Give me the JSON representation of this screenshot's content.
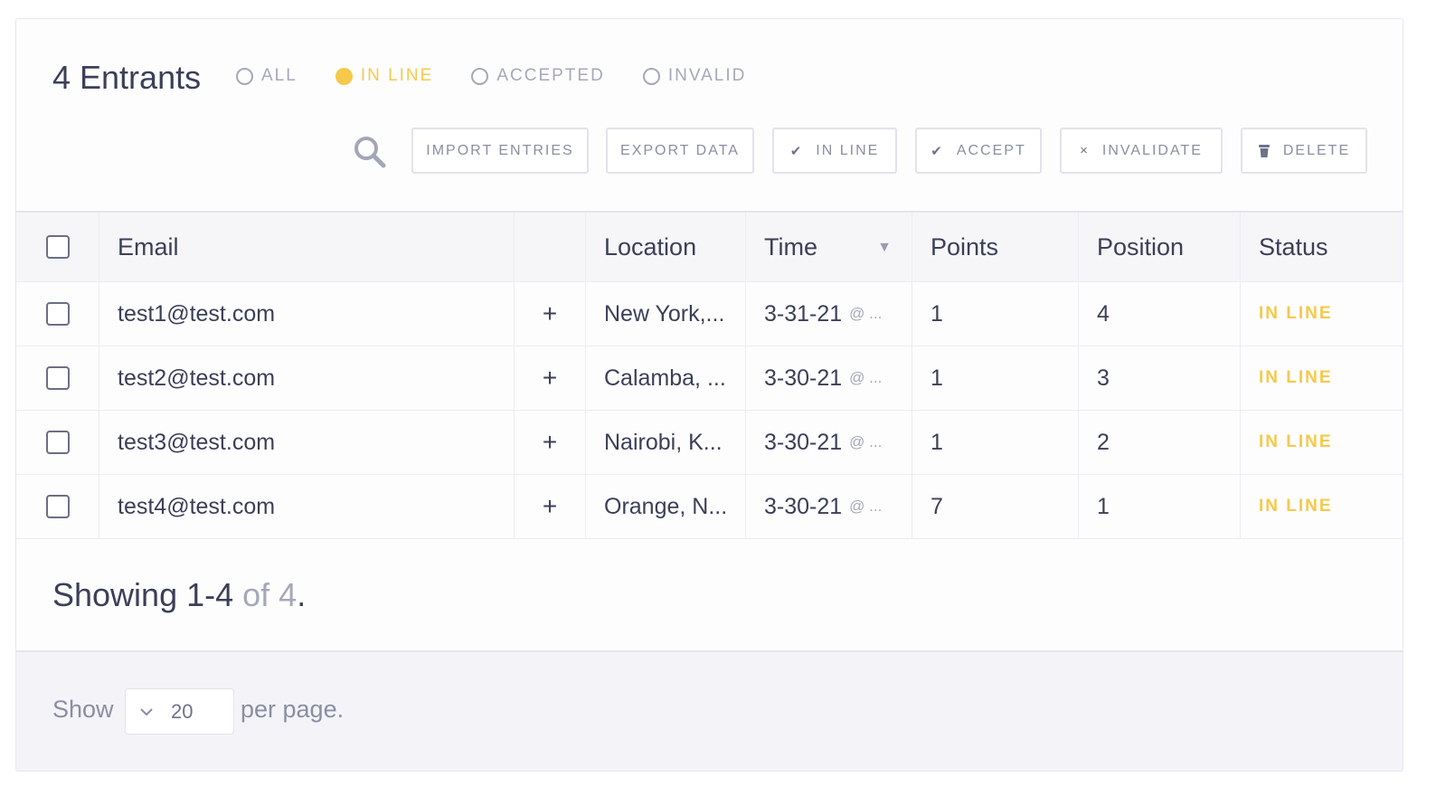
{
  "header": {
    "title": "4 Entrants",
    "filters": [
      {
        "label": "ALL",
        "active": false
      },
      {
        "label": "IN LINE",
        "active": true
      },
      {
        "label": "ACCEPTED",
        "active": false
      },
      {
        "label": "INVALID",
        "active": false
      }
    ]
  },
  "toolbar": {
    "search_icon": "search-icon",
    "import_label": "IMPORT ENTRIES",
    "export_label": "EXPORT DATA",
    "inline_label": "IN LINE",
    "accept_label": "ACCEPT",
    "invalidate_label": "INVALIDATE",
    "delete_label": "DELETE",
    "inline_icon": "check-icon",
    "accept_icon": "check-icon",
    "invalidate_icon": "x-icon",
    "delete_icon": "trash-icon"
  },
  "table": {
    "columns": {
      "email": "Email",
      "location": "Location",
      "time": "Time",
      "points": "Points",
      "position": "Position",
      "status": "Status"
    },
    "rows": [
      {
        "email": "test1@test.com",
        "plus": "+",
        "location": "New York,...",
        "time": "3-31-21",
        "time_suffix": "@ ...",
        "points": "1",
        "position": "4",
        "status": "IN LINE"
      },
      {
        "email": "test2@test.com",
        "plus": "+",
        "location": "Calamba, ...",
        "time": "3-30-21",
        "time_suffix": "@ ...",
        "points": "1",
        "position": "3",
        "status": "IN LINE"
      },
      {
        "email": "test3@test.com",
        "plus": "+",
        "location": "Nairobi, K...",
        "time": "3-30-21",
        "time_suffix": "@ ...",
        "points": "1",
        "position": "2",
        "status": "IN LINE"
      },
      {
        "email": "test4@test.com",
        "plus": "+",
        "location": "Orange, N...",
        "time": "3-30-21",
        "time_suffix": "@ ...",
        "points": "7",
        "position": "1",
        "status": "IN LINE"
      }
    ]
  },
  "summary": {
    "showing_prefix": "Showing 1-4",
    "showing_suffix": "of 4",
    "period": "."
  },
  "footer": {
    "show_label": "Show",
    "per_page_value": "20",
    "per_page_label": "per page."
  },
  "colors": {
    "accent": "#f6c94b",
    "text": "#3c3f58",
    "muted": "#a5a8b8"
  }
}
